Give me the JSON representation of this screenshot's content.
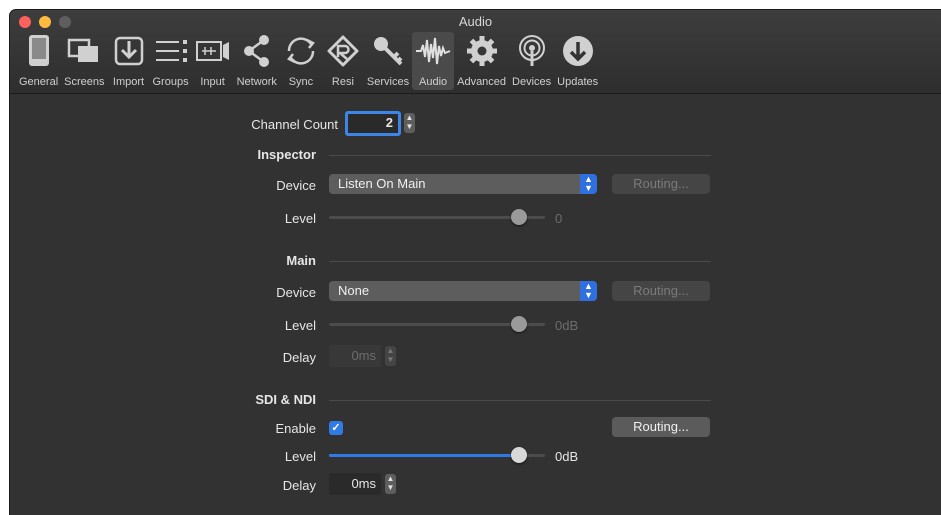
{
  "window": {
    "title": "Audio"
  },
  "toolbar": {
    "items": [
      {
        "label": "General",
        "icon": "general-icon"
      },
      {
        "label": "Screens",
        "icon": "screens-icon"
      },
      {
        "label": "Import",
        "icon": "import-icon"
      },
      {
        "label": "Groups",
        "icon": "groups-icon"
      },
      {
        "label": "Input",
        "icon": "input-icon"
      },
      {
        "label": "Network",
        "icon": "network-icon"
      },
      {
        "label": "Sync",
        "icon": "sync-icon"
      },
      {
        "label": "Resi",
        "icon": "resi-icon"
      },
      {
        "label": "Services",
        "icon": "services-icon"
      },
      {
        "label": "Audio",
        "icon": "audio-icon",
        "active": true
      },
      {
        "label": "Advanced",
        "icon": "advanced-icon"
      },
      {
        "label": "Devices",
        "icon": "devices-icon"
      },
      {
        "label": "Updates",
        "icon": "updates-icon"
      }
    ]
  },
  "channel_count": {
    "label": "Channel Count",
    "value": "2"
  },
  "inspector": {
    "heading": "Inspector",
    "device_label": "Device",
    "device_value": "Listen On Main",
    "routing_label": "Routing...",
    "level_label": "Level",
    "level_value": "0",
    "level_fraction": 1.0
  },
  "main": {
    "heading": "Main",
    "device_label": "Device",
    "device_value": "None",
    "routing_label": "Routing...",
    "level_label": "Level",
    "level_value": "0dB",
    "level_fraction": 1.0,
    "delay_label": "Delay",
    "delay_value": "0ms"
  },
  "sdi_ndi": {
    "heading": "SDI & NDI",
    "enable_label": "Enable",
    "enabled": true,
    "routing_label": "Routing...",
    "level_label": "Level",
    "level_value": "0dB",
    "level_fraction": 1.0,
    "delay_label": "Delay",
    "delay_value": "0ms"
  },
  "colors": {
    "accent": "#2f7ae5",
    "background": "#323232"
  }
}
